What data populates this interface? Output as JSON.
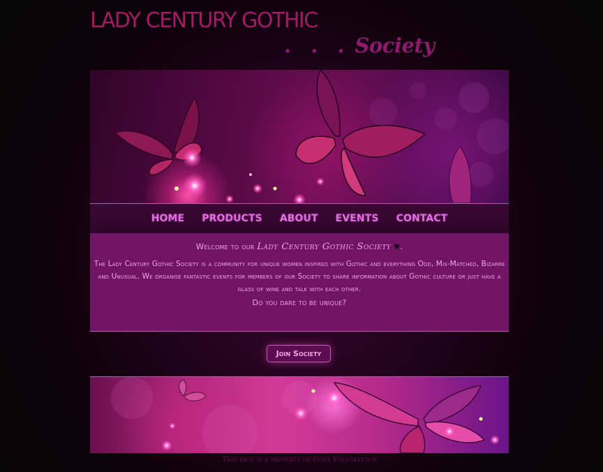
{
  "header": {
    "title": "LADY CENTURY GOTHIC",
    "subtitle_dots": ". . .",
    "subtitle": "Society"
  },
  "nav": {
    "items": [
      {
        "label": "HOME"
      },
      {
        "label": "PRODUCTS"
      },
      {
        "label": "ABOUT"
      },
      {
        "label": "EVENTS"
      },
      {
        "label": "CONTACT"
      }
    ]
  },
  "content": {
    "welcome_prefix": "Welcome to our",
    "welcome_name": "Lady Century Gothic Society",
    "heart_symbol": "♥",
    "welcome_suffix": ".",
    "description": "The Lady Century Gothic Society is a community for unique women inspired with Gothic and everything Odd, Mis-Matched, Bizarre and Unusual. We organise fantastic events for members of our Society to share information about Gothic culture or just have a glass of wine and talk with each other.",
    "question": "Do you dare to be unique?"
  },
  "cta": {
    "label": "Join Society"
  },
  "footer": {
    "copyright": "This page is a property of Olha Volotkevych"
  },
  "colors": {
    "accent": "#e06ee0",
    "title": "#a31a66",
    "content_bg": "#701463",
    "content_text": "#f0a6e6",
    "border": "#c752b2"
  },
  "icons": {
    "heart": "heart-icon",
    "banner_art": "butterfly-icon"
  }
}
